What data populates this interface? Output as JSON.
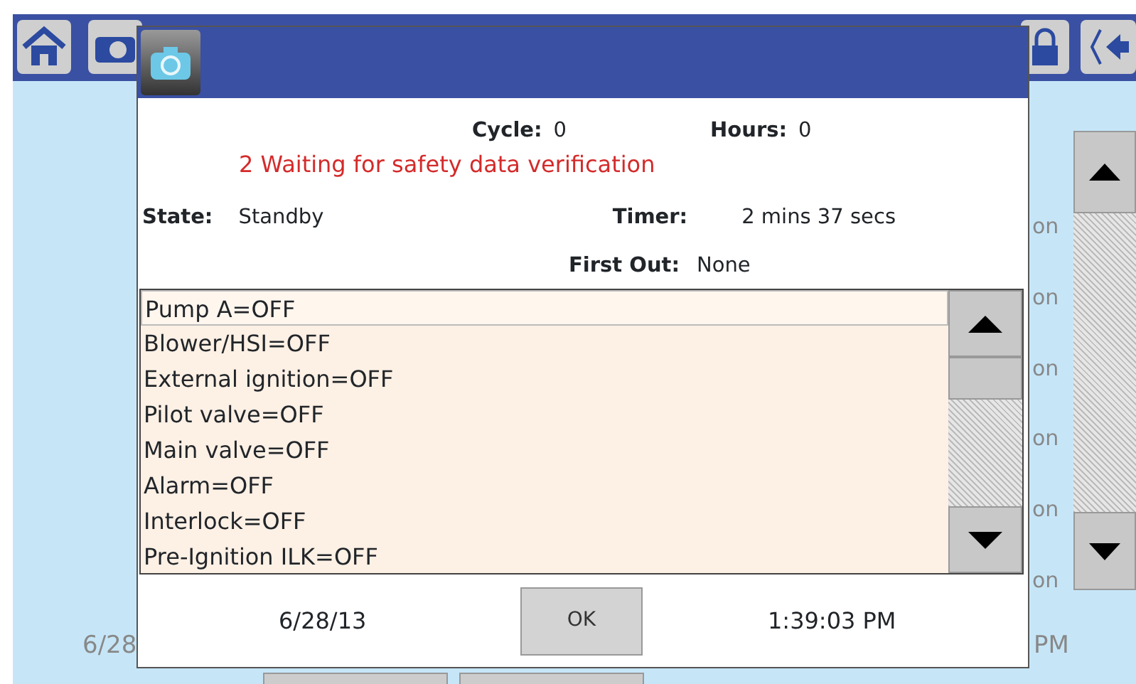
{
  "background": {
    "side_labels": [
      "on",
      "on",
      "on",
      "on",
      "on",
      "on"
    ],
    "date": "6/28",
    "time": "PM"
  },
  "dialog": {
    "cycle_label": "Cycle:",
    "cycle": "0",
    "hours_label": "Hours:",
    "hours": "0",
    "alert": "2 Waiting for safety data verification",
    "state_label": "State:",
    "state": "Standby",
    "timer_label": "Timer:",
    "timer": "2 mins 37 secs",
    "first_out_label": "First Out:",
    "first_out": "None",
    "items": [
      {
        "text": "Pump A=OFF",
        "selected": true
      },
      {
        "text": "Blower/HSI=OFF",
        "selected": false
      },
      {
        "text": "External ignition=OFF",
        "selected": false
      },
      {
        "text": "Pilot valve=OFF",
        "selected": false
      },
      {
        "text": "Main valve=OFF",
        "selected": false
      },
      {
        "text": "Alarm=OFF",
        "selected": false
      },
      {
        "text": "Interlock=OFF",
        "selected": false
      },
      {
        "text": "Pre-Ignition ILK=OFF",
        "selected": false
      }
    ],
    "date": "6/28/13",
    "ok": "OK",
    "time": "1:39:03 PM"
  }
}
